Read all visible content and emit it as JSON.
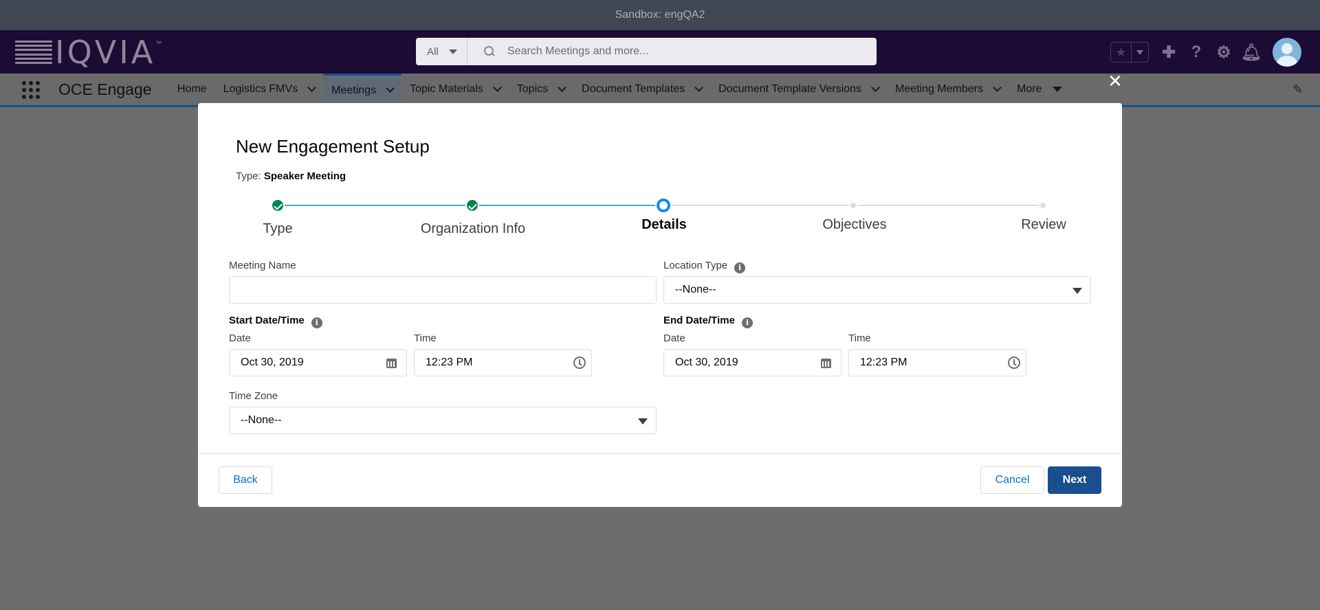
{
  "sandbox": {
    "label": "Sandbox: engQA2"
  },
  "header": {
    "logo_text": "IQVIA",
    "logo_tm": "™",
    "search_scope": "All",
    "search_placeholder": "Search Meetings and more..."
  },
  "nav": {
    "app_name": "OCE Engage",
    "items": [
      {
        "label": "Home"
      },
      {
        "label": "Logistics FMVs"
      },
      {
        "label": "Meetings"
      },
      {
        "label": "Topic Materials"
      },
      {
        "label": "Topics"
      },
      {
        "label": "Document Templates"
      },
      {
        "label": "Document Template Versions"
      },
      {
        "label": "Meeting Members"
      },
      {
        "label": "More"
      }
    ]
  },
  "modal": {
    "title": "New Engagement Setup",
    "type_prefix": "Type:",
    "type_value": "Speaker Meeting",
    "steps": [
      {
        "label": "Type",
        "state": "complete"
      },
      {
        "label": "Organization Info",
        "state": "complete"
      },
      {
        "label": "Details",
        "state": "current"
      },
      {
        "label": "Objectives",
        "state": "incomplete"
      },
      {
        "label": "Review",
        "state": "incomplete"
      }
    ],
    "form": {
      "meeting_name_label": "Meeting Name",
      "meeting_name_value": "",
      "location_type_label": "Location Type",
      "location_type_value": "--None--",
      "start_label": "Start Date/Time",
      "start_date_label": "Date",
      "start_date_value": "Oct 30, 2019",
      "start_time_label": "Time",
      "start_time_value": "12:23 PM",
      "end_label": "End Date/Time",
      "end_date_label": "Date",
      "end_date_value": "Oct 30, 2019",
      "end_time_label": "Time",
      "end_time_value": "12:23 PM",
      "timezone_label": "Time Zone",
      "timezone_value": "--None--"
    },
    "footer": {
      "back_label": "Back",
      "cancel_label": "Cancel",
      "next_label": "Next"
    }
  },
  "colors": {
    "brand": "#1a4f8f",
    "complete": "#04844b",
    "current": "#1589ee",
    "header_bg": "#1c0b35"
  }
}
